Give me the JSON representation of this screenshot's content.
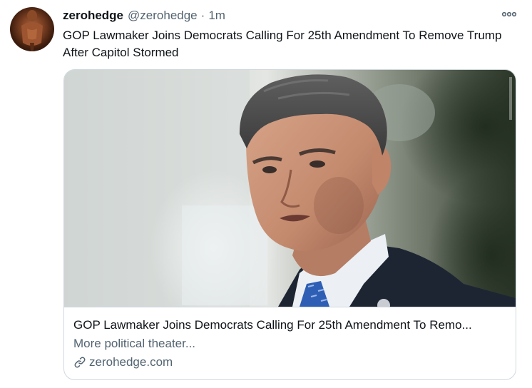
{
  "tweet": {
    "display_name": "zerohedge",
    "handle": "@zerohedge",
    "separator": "·",
    "time": "1m",
    "text": "GOP Lawmaker Joins Democrats Calling For 25th Amendment To Remove Trump After Capitol Stormed",
    "more_icon": "more-horizontal-icon"
  },
  "card": {
    "title": "GOP Lawmaker Joins Democrats Calling For 25th Amendment To Remo...",
    "description": "More political theater...",
    "domain": "zerohedge.com",
    "domain_icon": "link-icon"
  },
  "colors": {
    "primary_text": "#0f1419",
    "secondary_text": "#536471",
    "border": "#cfd9de"
  }
}
